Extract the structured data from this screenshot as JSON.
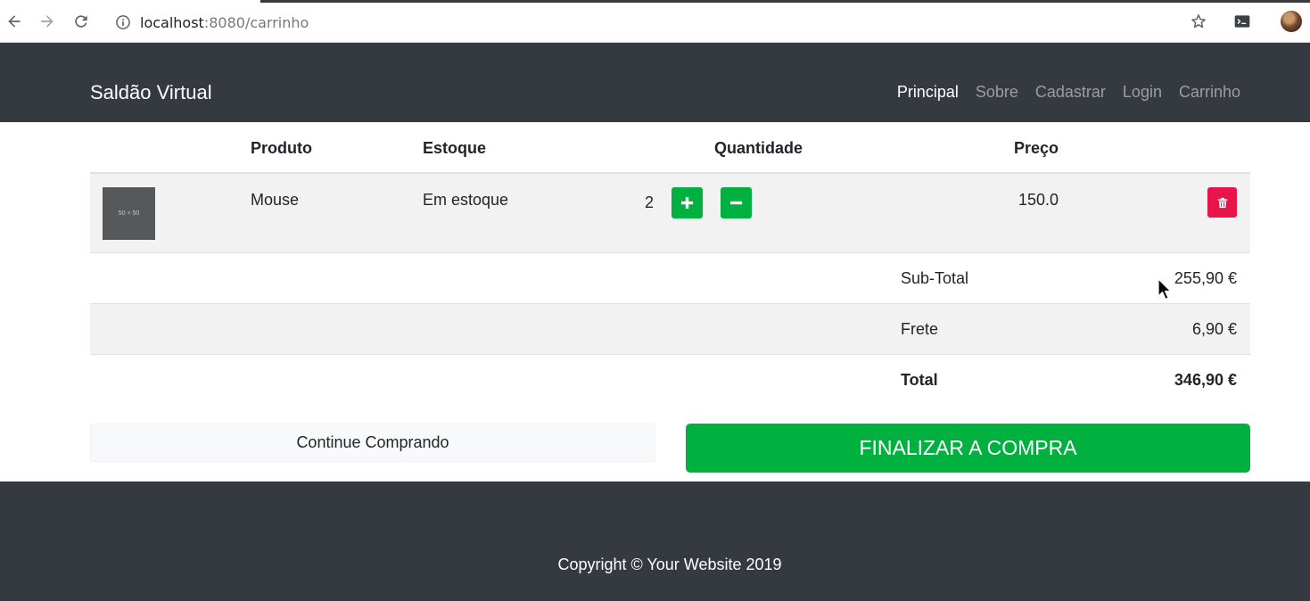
{
  "browser": {
    "url_host": "localhost",
    "url_path": ":8080/carrinho",
    "icons": [
      "back-arrow-icon",
      "forward-arrow-icon",
      "reload-icon",
      "info-icon",
      "star-icon",
      "terminal-extension-icon",
      "profile-avatar"
    ]
  },
  "navbar": {
    "brand": "Saldão Virtual",
    "links": [
      {
        "label": "Principal",
        "active": true
      },
      {
        "label": "Sobre",
        "active": false
      },
      {
        "label": "Cadastrar",
        "active": false
      },
      {
        "label": "Login",
        "active": false
      },
      {
        "label": "Carrinho",
        "active": false
      }
    ]
  },
  "cart": {
    "headers": {
      "produto": "Produto",
      "estoque": "Estoque",
      "quantidade": "Quantidade",
      "preco": "Preço"
    },
    "items": [
      {
        "thumb_text": "50 × 50",
        "product": "Mouse",
        "stock": "Em estoque",
        "quantity": "2",
        "price": "150.0"
      }
    ],
    "summary": {
      "subtotal_label": "Sub-Total",
      "subtotal_value": "255,90 €",
      "shipping_label": "Frete",
      "shipping_value": "6,90 €",
      "total_label": "Total",
      "total_value": "346,90 €"
    }
  },
  "actions": {
    "continue_label": "Continue Comprando",
    "checkout_label": "FINALIZAR A COMPRA"
  },
  "footer": {
    "copyright": "Copyright © Your Website 2019"
  },
  "colors": {
    "navbar_bg": "#343a40",
    "success": "#00b140",
    "danger": "#e8154a",
    "stripe": "#f2f2f2"
  }
}
